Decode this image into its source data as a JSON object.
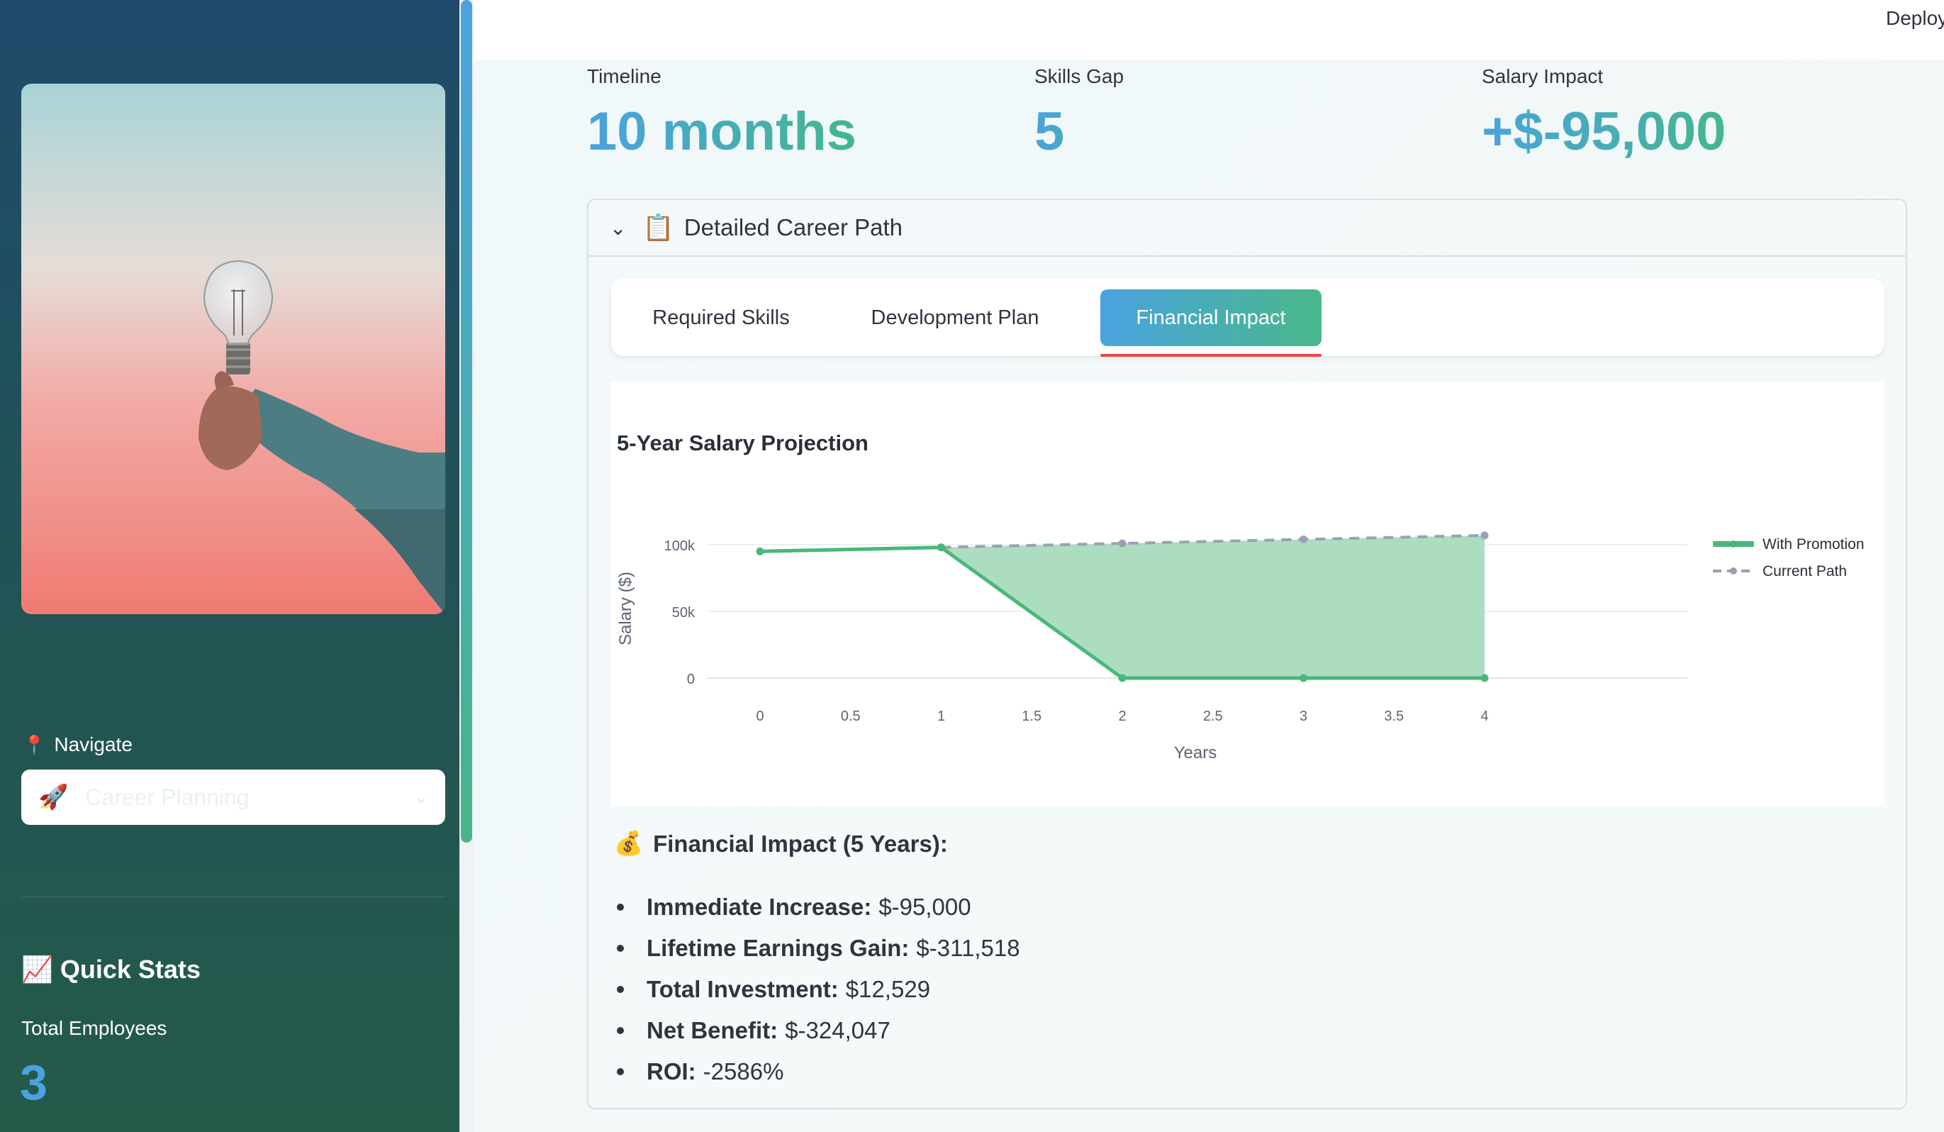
{
  "topbar": {
    "deploy_label": "Deploy"
  },
  "sidebar": {
    "nav_label": "Navigate",
    "nav_select_value": "Career Planning",
    "quick_stats_title": "Quick Stats",
    "stat_label": "Total Employees",
    "stat_value": "3"
  },
  "metrics": [
    {
      "label": "Timeline",
      "value": "10 months"
    },
    {
      "label": "Skills Gap",
      "value": "5"
    },
    {
      "label": "Salary Impact",
      "value": "+$-95,000"
    }
  ],
  "expander": {
    "title": "Detailed Career Path"
  },
  "tabs": [
    {
      "label": "Required Skills",
      "active": false
    },
    {
      "label": "Development Plan",
      "active": false
    },
    {
      "label": "Financial Impact",
      "active": true
    }
  ],
  "chart_data": {
    "type": "line",
    "title": "5-Year Salary Projection",
    "xlabel": "Years",
    "ylabel": "Salary ($)",
    "x": [
      0,
      1,
      2,
      3,
      4
    ],
    "xticks": [
      "0",
      "0.5",
      "1",
      "1.5",
      "2",
      "2.5",
      "3",
      "3.5",
      "4"
    ],
    "yticks": [
      "0",
      "50k",
      "100k"
    ],
    "ylim": [
      0,
      110000
    ],
    "xlim": [
      0,
      4
    ],
    "legend_position": "right",
    "series": [
      {
        "name": "With Promotion",
        "values": [
          95000,
          98000,
          0,
          0,
          0
        ],
        "color": "#49b87a",
        "style": "solid"
      },
      {
        "name": "Current Path",
        "values": [
          null,
          98000,
          101000,
          104000,
          107000
        ],
        "color": "#9aa0b5",
        "style": "dashed"
      }
    ],
    "fill_color": "#a8dbbd"
  },
  "financial": {
    "title": "Financial Impact (5 Years):",
    "items": [
      {
        "label": "Immediate Increase:",
        "value": "$-95,000"
      },
      {
        "label": "Lifetime Earnings Gain:",
        "value": "$-311,518"
      },
      {
        "label": "Total Investment:",
        "value": "$12,529"
      },
      {
        "label": "Net Benefit:",
        "value": "$-324,047"
      },
      {
        "label": "ROI:",
        "value": "-2586%"
      }
    ]
  },
  "icons": {
    "pin": "round-pushpin-icon",
    "rocket": "rocket-icon",
    "chart": "chart-increasing-icon",
    "clipboard": "clipboard-icon",
    "money": "money-bag-icon"
  }
}
